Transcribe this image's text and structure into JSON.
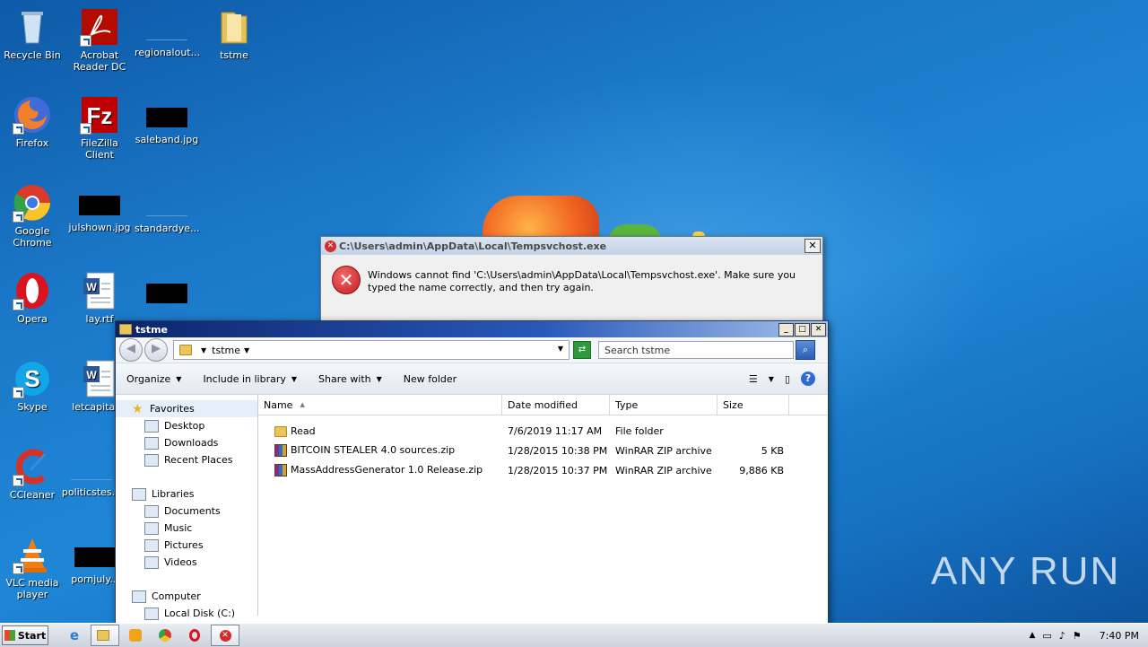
{
  "desktop": {
    "icons": [
      {
        "label": "Recycle Bin"
      },
      {
        "label": "Acrobat Reader DC"
      },
      {
        "label": "regionalout..."
      },
      {
        "label": "tstme"
      },
      {
        "label": "Firefox"
      },
      {
        "label": "FileZilla Client"
      },
      {
        "label": "saleband.jpg"
      },
      {
        "label": "Google Chrome"
      },
      {
        "label": "julshown.jpg"
      },
      {
        "label": "standardye..."
      },
      {
        "label": "Opera"
      },
      {
        "label": "lay.rtf"
      },
      {
        "label": "Skype"
      },
      {
        "label": "letcapital..."
      },
      {
        "label": "CCleaner"
      },
      {
        "label": "politicstes..."
      },
      {
        "label": "VLC media player"
      },
      {
        "label": "pornjuly..."
      }
    ]
  },
  "error_dialog": {
    "title": "C:\\Users\\admin\\AppData\\Local\\Tempsvchost.exe",
    "message": "Windows cannot find 'C:\\Users\\admin\\AppData\\Local\\Tempsvchost.exe'. Make sure you typed the name correctly, and then try again.",
    "close": "✕"
  },
  "explorer": {
    "title": "tstme",
    "window_buttons": {
      "minimize": "_",
      "maximize": "□",
      "close": "✕"
    },
    "address": "tstme",
    "search_placeholder": "Search tstme",
    "commands": {
      "organize": "Organize",
      "include": "Include in library",
      "share": "Share with",
      "new_folder": "New folder"
    },
    "nav": {
      "favorites": "Favorites",
      "desktop": "Desktop",
      "downloads": "Downloads",
      "recent": "Recent Places",
      "libraries": "Libraries",
      "documents": "Documents",
      "music": "Music",
      "pictures": "Pictures",
      "videos": "Videos",
      "computer": "Computer",
      "local_disk": "Local Disk (C:)"
    },
    "columns": {
      "name": "Name",
      "date": "Date modified",
      "type": "Type",
      "size": "Size"
    },
    "files": [
      {
        "name": "Read",
        "date": "7/6/2019 11:17 AM",
        "type": "File folder",
        "size": ""
      },
      {
        "name": "BITCOIN STEALER 4.0 sources.zip",
        "date": "1/28/2015 10:38 PM",
        "type": "WinRAR ZIP archive",
        "size": "5 KB"
      },
      {
        "name": "MassAddressGenerator 1.0 Release.zip",
        "date": "1/28/2015 10:37 PM",
        "type": "WinRAR ZIP archive",
        "size": "9,886 KB"
      }
    ]
  },
  "taskbar": {
    "start": "Start",
    "clock": "7:40 PM"
  },
  "watermark": "ANY RUN"
}
